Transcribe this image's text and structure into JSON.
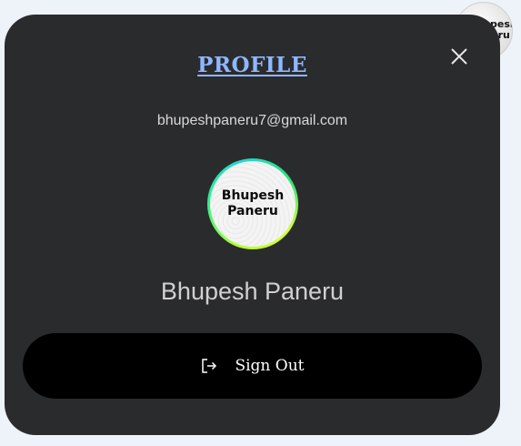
{
  "background_avatar": {
    "text": "Bhupesh\nPaneru"
  },
  "profile_modal": {
    "title": "PROFILE",
    "email": "bhupeshpaneru7@gmail.com",
    "avatar_text": "Bhupesh\nPaneru",
    "name": "Bhupesh Paneru",
    "signout_label": "Sign Out",
    "close_icon": "close-icon",
    "signout_icon": "sign-out-icon"
  },
  "colors": {
    "modal_background": "#2a2b2d",
    "title": "#8fb7ff",
    "button_background": "#000000",
    "page_background": "#eef2f9"
  }
}
